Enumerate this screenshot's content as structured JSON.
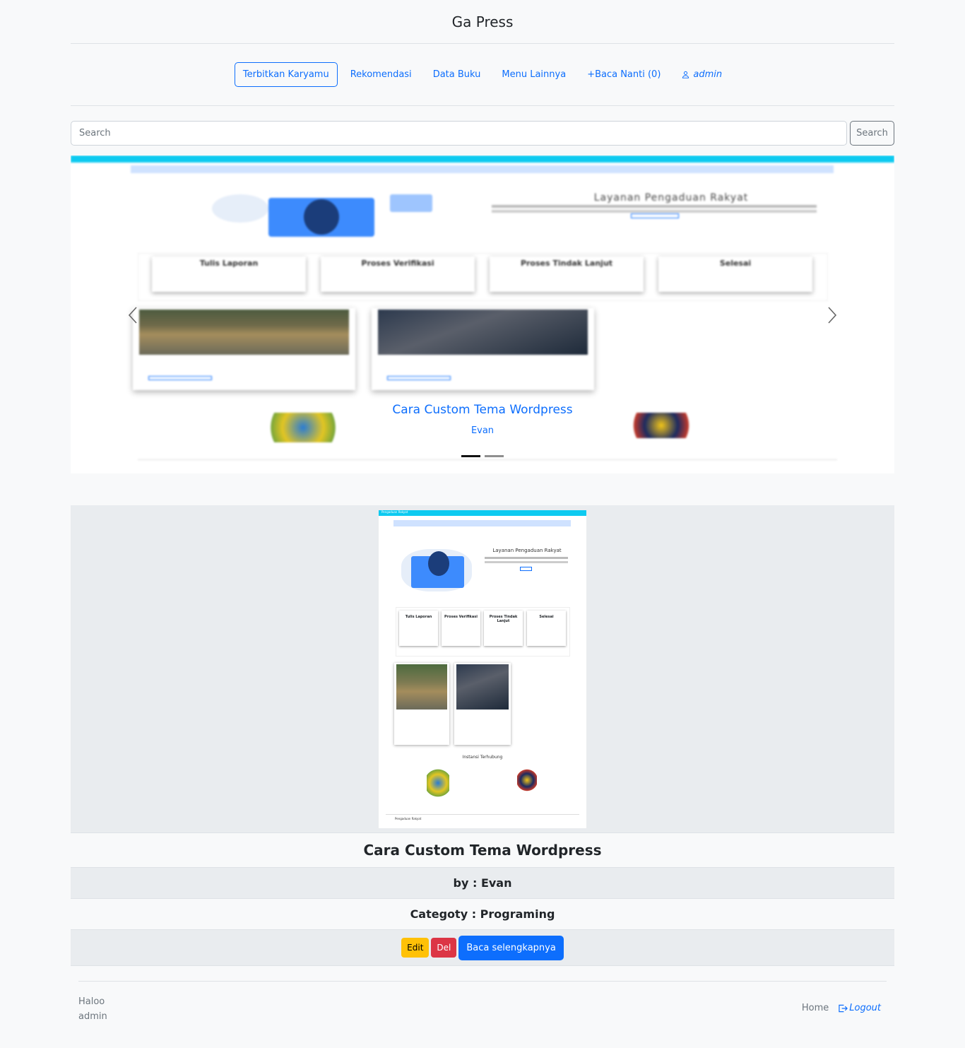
{
  "brand": "Ga Press",
  "nav": {
    "items": [
      {
        "label": "Terbitkan Karyamu"
      },
      {
        "label": "Rekomendasi"
      },
      {
        "label": "Data Buku"
      },
      {
        "label": "Menu Lainnya"
      },
      {
        "label": "+Baca Nanti (0)"
      }
    ],
    "user": "admin"
  },
  "search": {
    "placeholder": "Search",
    "button": "Search"
  },
  "carousel": {
    "title": "Cara Custom Tema Wordpress",
    "author": "Evan",
    "slides": 2,
    "active_slide": 1
  },
  "preview": {
    "site_name": "Pengaduan Rakyat",
    "hero_title": "Layanan Pengaduan Rakyat",
    "steps": [
      "Tulis Laporan",
      "Proses Verifikasi",
      "Proses Tindak Lanjut",
      "Selesai"
    ],
    "section": "Instansi Terhubung",
    "footer": "Pengaduan Rakyat"
  },
  "post": {
    "title": "Cara Custom Tema Wordpress",
    "author_line": "by : Evan",
    "category_line": "Categoty : Programing",
    "edit": "Edit",
    "del": "Del",
    "read_more": "Baca selengkapnya"
  },
  "footer": {
    "greeting_1": "Haloo",
    "greeting_2": "admin",
    "home": "Home",
    "logout": "Logout"
  },
  "colors": {
    "primary": "#0d6efd",
    "warning": "#ffc107",
    "danger": "#dc3545",
    "info": "#0dcaf0"
  }
}
